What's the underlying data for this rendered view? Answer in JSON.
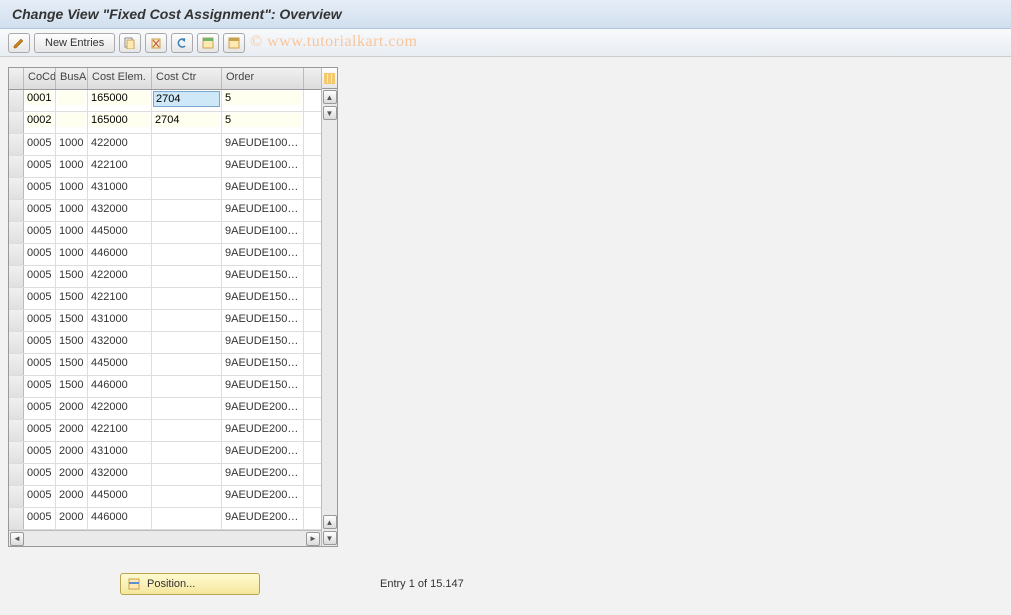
{
  "title": "Change View \"Fixed Cost Assignment\": Overview",
  "watermark": "© www.tutorialkart.com",
  "toolbar": {
    "new_entries_label": "New Entries"
  },
  "columns": {
    "cocd": "CoCd",
    "busa": "BusA",
    "elem": "Cost Elem.",
    "cctr": "Cost Ctr",
    "order": "Order"
  },
  "rows": [
    {
      "cocd": "0001",
      "busa": "",
      "elem": "165000",
      "cctr": "2704",
      "order": "5",
      "editable": true,
      "highlight_cctr": true
    },
    {
      "cocd": "0002",
      "busa": "",
      "elem": "165000",
      "cctr": "2704",
      "order": "5",
      "editable": true
    },
    {
      "cocd": "0005",
      "busa": "1000",
      "elem": "422000",
      "cctr": "",
      "order": "9AEUDE100…"
    },
    {
      "cocd": "0005",
      "busa": "1000",
      "elem": "422100",
      "cctr": "",
      "order": "9AEUDE100…"
    },
    {
      "cocd": "0005",
      "busa": "1000",
      "elem": "431000",
      "cctr": "",
      "order": "9AEUDE100…"
    },
    {
      "cocd": "0005",
      "busa": "1000",
      "elem": "432000",
      "cctr": "",
      "order": "9AEUDE100…"
    },
    {
      "cocd": "0005",
      "busa": "1000",
      "elem": "445000",
      "cctr": "",
      "order": "9AEUDE100…"
    },
    {
      "cocd": "0005",
      "busa": "1000",
      "elem": "446000",
      "cctr": "",
      "order": "9AEUDE100…"
    },
    {
      "cocd": "0005",
      "busa": "1500",
      "elem": "422000",
      "cctr": "",
      "order": "9AEUDE150…"
    },
    {
      "cocd": "0005",
      "busa": "1500",
      "elem": "422100",
      "cctr": "",
      "order": "9AEUDE150…"
    },
    {
      "cocd": "0005",
      "busa": "1500",
      "elem": "431000",
      "cctr": "",
      "order": "9AEUDE150…"
    },
    {
      "cocd": "0005",
      "busa": "1500",
      "elem": "432000",
      "cctr": "",
      "order": "9AEUDE150…"
    },
    {
      "cocd": "0005",
      "busa": "1500",
      "elem": "445000",
      "cctr": "",
      "order": "9AEUDE150…"
    },
    {
      "cocd": "0005",
      "busa": "1500",
      "elem": "446000",
      "cctr": "",
      "order": "9AEUDE150…"
    },
    {
      "cocd": "0005",
      "busa": "2000",
      "elem": "422000",
      "cctr": "",
      "order": "9AEUDE200…"
    },
    {
      "cocd": "0005",
      "busa": "2000",
      "elem": "422100",
      "cctr": "",
      "order": "9AEUDE200…"
    },
    {
      "cocd": "0005",
      "busa": "2000",
      "elem": "431000",
      "cctr": "",
      "order": "9AEUDE200…"
    },
    {
      "cocd": "0005",
      "busa": "2000",
      "elem": "432000",
      "cctr": "",
      "order": "9AEUDE200…"
    },
    {
      "cocd": "0005",
      "busa": "2000",
      "elem": "445000",
      "cctr": "",
      "order": "9AEUDE200…"
    },
    {
      "cocd": "0005",
      "busa": "2000",
      "elem": "446000",
      "cctr": "",
      "order": "9AEUDE200…"
    }
  ],
  "footer": {
    "position_label": "Position...",
    "status": "Entry 1 of 15.147"
  }
}
